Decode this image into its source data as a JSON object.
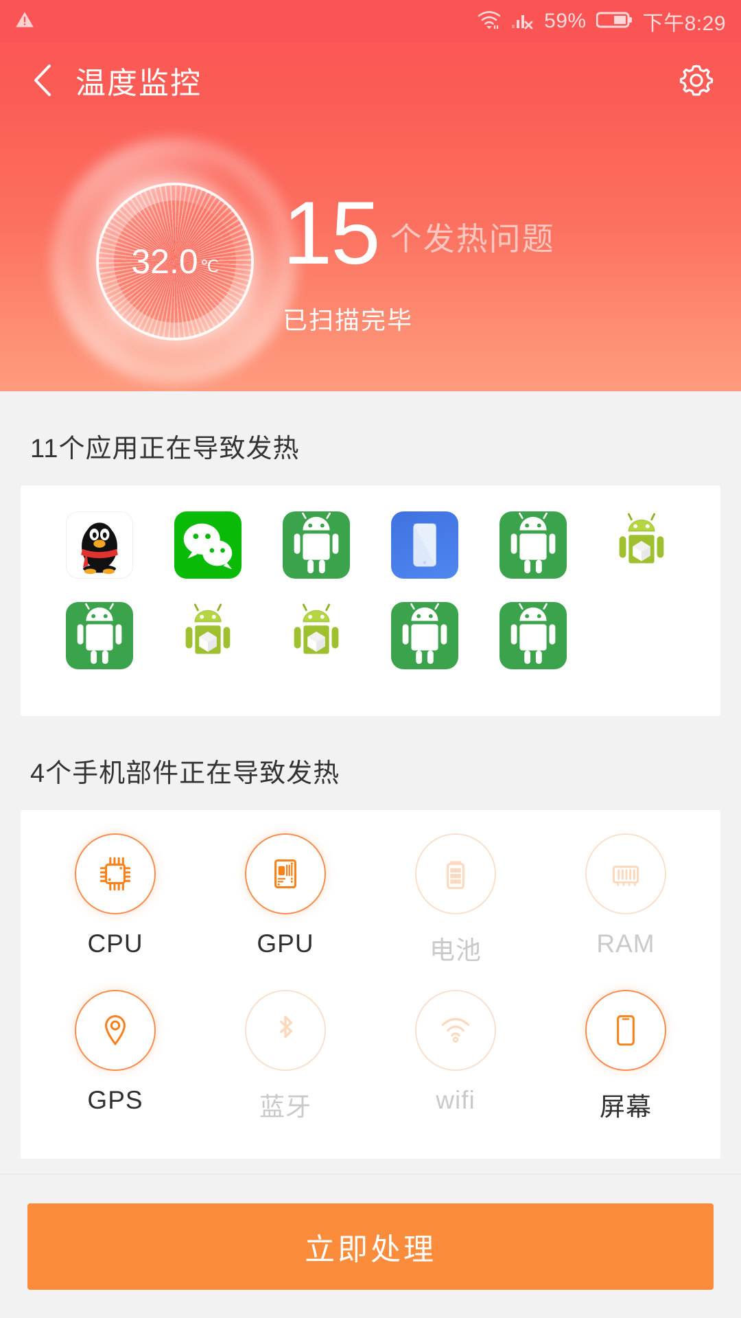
{
  "status_bar": {
    "warning_icon": "warning-triangle-icon",
    "wifi_icon": "wifi-icon",
    "signal_icon": "signal-no-service-icon",
    "battery_percent": "59%",
    "battery_icon": "battery-icon",
    "time": "下午8:29"
  },
  "nav": {
    "back_icon": "chevron-left-icon",
    "title": "温度监控",
    "settings_icon": "gear-icon"
  },
  "hero": {
    "temperature": "32.0",
    "temperature_unit": "℃",
    "issue_count": "15",
    "issue_count_unit": "个发热问题",
    "scan_status": "已扫描完毕",
    "bg_color_top": "#fb5456",
    "bg_color_bottom": "#fe9b7f"
  },
  "apps_section": {
    "title": "11个应用正在导致发热",
    "apps": [
      {
        "name": "qq",
        "icon": "qq-penguin-icon",
        "style": "qq"
      },
      {
        "name": "wechat",
        "icon": "wechat-icon",
        "style": "wechat"
      },
      {
        "name": "android-app-1",
        "icon": "android-robot-icon",
        "style": "android-green"
      },
      {
        "name": "blue-app",
        "icon": "blue-phone-icon",
        "style": "blue"
      },
      {
        "name": "android-app-2",
        "icon": "android-robot-icon",
        "style": "android-green"
      },
      {
        "name": "android-app-3",
        "icon": "android-3d-robot-icon",
        "style": "plain"
      },
      {
        "name": "android-app-4",
        "icon": "android-robot-icon",
        "style": "android-green"
      },
      {
        "name": "android-app-5",
        "icon": "android-3d-robot-icon",
        "style": "plain"
      },
      {
        "name": "android-app-6",
        "icon": "android-3d-robot-icon",
        "style": "plain"
      },
      {
        "name": "android-app-7",
        "icon": "android-robot-icon",
        "style": "android-green"
      },
      {
        "name": "android-app-8",
        "icon": "android-robot-icon",
        "style": "android-green"
      }
    ]
  },
  "components_section": {
    "title": "4个手机部件正在导致发热",
    "components": [
      {
        "label": "CPU",
        "icon": "cpu-chip-icon",
        "active": true
      },
      {
        "label": "GPU",
        "icon": "gpu-board-icon",
        "active": true
      },
      {
        "label": "电池",
        "icon": "battery-icon",
        "active": false
      },
      {
        "label": "RAM",
        "icon": "ram-memory-icon",
        "active": false
      },
      {
        "label": "GPS",
        "icon": "location-pin-icon",
        "active": true
      },
      {
        "label": "蓝牙",
        "icon": "bluetooth-icon",
        "active": false
      },
      {
        "label": "wifi",
        "icon": "wifi-icon",
        "active": false
      },
      {
        "label": "屏幕",
        "icon": "screen-phone-icon",
        "active": true
      }
    ]
  },
  "footer": {
    "action_label": "立即处理",
    "action_color": "#fb8c3c"
  }
}
